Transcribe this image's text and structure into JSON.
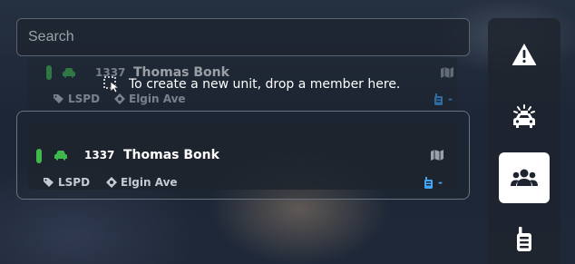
{
  "search": {
    "placeholder": "Search",
    "value": ""
  },
  "drag_ghost": {
    "callsign": "1337",
    "name": "Thomas Bonk",
    "department": "LSPD",
    "location": "Elgin Ave",
    "radio": "-"
  },
  "drop_hint": "To create a new unit, drop a member here.",
  "unit": {
    "callsign": "1337",
    "name": "Thomas Bonk",
    "department": "LSPD",
    "location": "Elgin Ave",
    "radio": "-",
    "status_color": "#3fb94b"
  },
  "sidebar": {
    "items": [
      {
        "icon": "warning-icon",
        "active": false
      },
      {
        "icon": "police-car-icon",
        "active": false
      },
      {
        "icon": "users-icon",
        "active": true
      },
      {
        "icon": "radio-icon",
        "active": false
      }
    ]
  },
  "colors": {
    "accent_green": "#3fb94b",
    "radio_blue": "#42a5f5",
    "active_tab": "#ffffff"
  }
}
